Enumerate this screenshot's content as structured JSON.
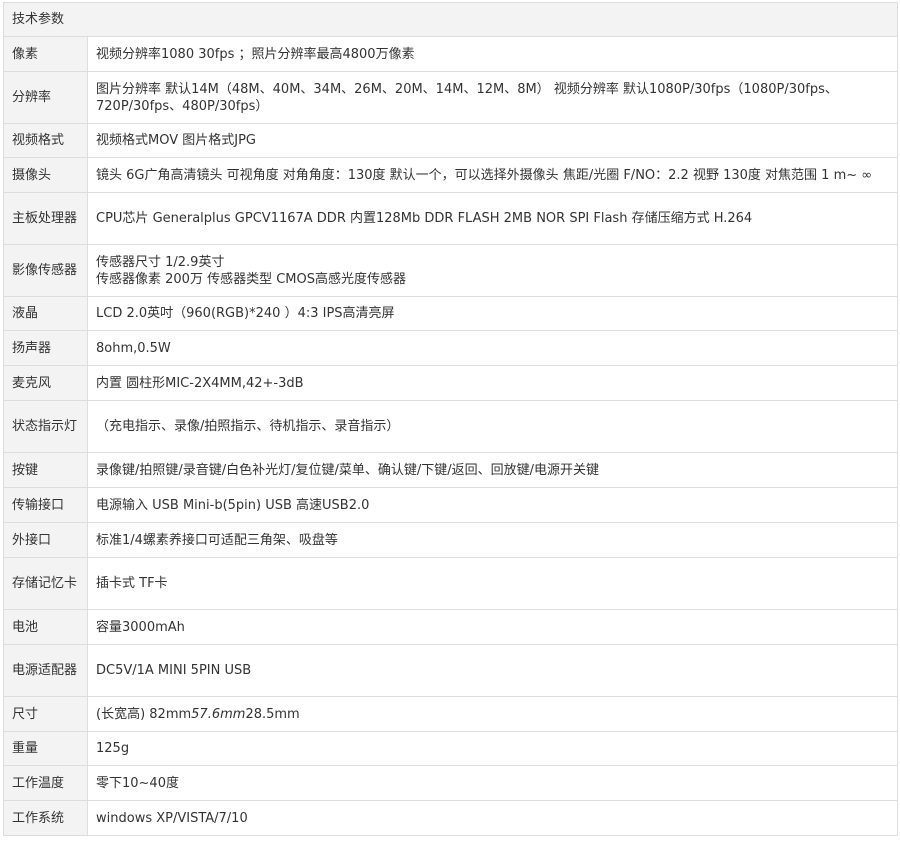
{
  "table": {
    "title": "技术参数",
    "rows": [
      {
        "label": "像素",
        "value": "视频分辨率1080 30fps ；照片分辨率最高4800万像素"
      },
      {
        "label": "分辨率",
        "value": "图片分辨率 默认14M（48M、40M、34M、26M、20M、14M、12M、8M） 视频分辨率 默认1080P/30fps（1080P/30fps、720P/30fps、480P/30fps）"
      },
      {
        "label": "视频格式",
        "value": "视频格式MOV 图片格式JPG"
      },
      {
        "label": "摄像头",
        "value": "镜头 6G广角高清镜头 可视角度 对角角度：130度 默认一个，可以选择外摄像头 焦距/光圈 F/NO：2.2 视野 130度 对焦范围 1 m~ ∞"
      },
      {
        "label": "主板处理器",
        "value": "CPU芯片 Generalplus GPCV1167A DDR 内置128Mb DDR FLASH 2MB NOR SPI Flash 存储压缩方式 H.264"
      },
      {
        "label": "影像传感器",
        "value_line1": "传感器尺寸 1/2.9英寸",
        "value_line2": "传感器像素 200万 传感器类型 CMOS高感光度传感器"
      },
      {
        "label": "液晶",
        "value": "LCD 2.0英吋（960(RGB)*240 ）4:3 IPS高清亮屏"
      },
      {
        "label": "扬声器",
        "value": "8ohm,0.5W"
      },
      {
        "label": "麦克风",
        "value": "内置 圆柱形MIC-2X4MM,42+-3dB"
      },
      {
        "label": "状态指示灯",
        "value": "（充电指示、录像/拍照指示、待机指示、录音指示）"
      },
      {
        "label": "按键",
        "value": "录像键/拍照键/录音键/白色补光灯/复位键/菜单、确认键/下键/返回、回放键/电源开关键"
      },
      {
        "label": "传输接口",
        "value": "电源输入 USB Mini-b(5pin) USB 高速USB2.0"
      },
      {
        "label": "外接口",
        "value": "标准1/4螺素养接口可适配三角架、吸盘等"
      },
      {
        "label": "存储记忆卡",
        "value": "插卡式 TF卡"
      },
      {
        "label": "电池",
        "value": "容量3000mAh"
      },
      {
        "label": "电源适配器",
        "value": "DC5V/1A MINI 5PIN USB"
      },
      {
        "label": "尺寸",
        "value_prefix": "(长宽高) 82mm",
        "value_italic": "57.6mm",
        "value_suffix": "28.5mm"
      },
      {
        "label": "重量",
        "value": "125g"
      },
      {
        "label": "工作温度",
        "value": "零下10~40度"
      },
      {
        "label": "工作系统",
        "value": "windows XP/VISTA/7/10"
      }
    ]
  }
}
